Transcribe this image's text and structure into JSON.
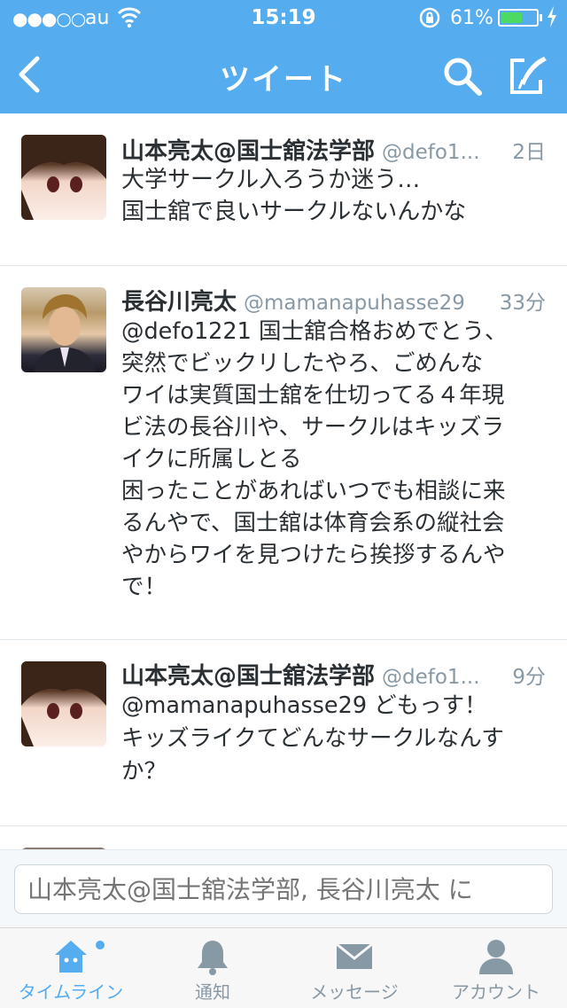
{
  "status_bar": {
    "signal": "●●●○○",
    "carrier": "au",
    "time": "15:19",
    "battery_percent": "61%",
    "battery_level": 0.61,
    "icons": [
      "wifi-icon",
      "rotation-lock-icon",
      "battery-icon",
      "charging-bolt-icon"
    ]
  },
  "navbar": {
    "title": "ツイート",
    "icons": [
      "back-chevron-icon",
      "search-icon",
      "compose-icon"
    ],
    "color": "#55acee"
  },
  "tweets": [
    {
      "name": "山本亮太@国士舘法学部",
      "handle": "@defo1...",
      "time": "2日",
      "text": "大学サークル入ろうか迷う…\n国士舘で良いサークルないんかな"
    },
    {
      "name": "長谷川亮太",
      "handle": "@mamanapuhasse29",
      "time": "33分",
      "text": "@defo1221 国士舘合格おめでとう、\n突然でビックリしたやろ、ごめんな\nワイは実質国士舘を仕切ってる４年現\nビ法の長谷川や、サークルはキッズラ\nイクに所属しとる\n困ったことがあればいつでも相談に来\nるんやで、国士舘は体育会系の縦社会\nやからワイを見つけたら挨拶するんや\nで！"
    },
    {
      "name": "山本亮太@国士舘法学部",
      "handle": "@defo1...",
      "time": "9分",
      "text": "@mamanapuhasse29 どもっす！\nキッズライクてどんなサークルなんす\nか？"
    }
  ],
  "reply": {
    "placeholder": "山本亮太@国士舘法学部, 長谷川亮太 に"
  },
  "tabbar": {
    "tabs": [
      {
        "label": "タイムライン",
        "icon": "home-icon",
        "active": true
      },
      {
        "label": "通知",
        "icon": "bell-icon",
        "active": false
      },
      {
        "label": "メッセージ",
        "icon": "envelope-icon",
        "active": false
      },
      {
        "label": "アカウント",
        "icon": "person-icon",
        "active": false
      }
    ],
    "active_color": "#55acee"
  }
}
